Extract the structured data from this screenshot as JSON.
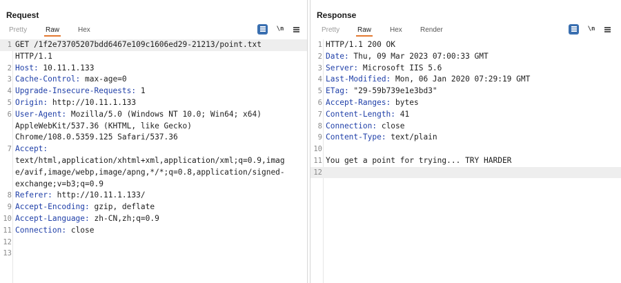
{
  "request": {
    "title": "Request",
    "tabs": [
      "Pretty",
      "Raw",
      "Hex"
    ],
    "active_tab": "Raw",
    "newline_label": "\\n",
    "lines": [
      {
        "num": "1",
        "key": "",
        "text": "GET /1f2e73705207bdd6467e109c1606ed29-21213/point.txt"
      },
      {
        "num": "",
        "key": "",
        "text": "HTTP/1.1"
      },
      {
        "num": "2",
        "key": "Host:",
        "text": " 10.11.1.133"
      },
      {
        "num": "3",
        "key": "Cache-Control:",
        "text": " max-age=0"
      },
      {
        "num": "4",
        "key": "Upgrade-Insecure-Requests:",
        "text": " 1"
      },
      {
        "num": "5",
        "key": "Origin:",
        "text": " http://10.11.1.133"
      },
      {
        "num": "6",
        "key": "User-Agent:",
        "text": " Mozilla/5.0 (Windows NT 10.0; Win64; x64)"
      },
      {
        "num": "",
        "key": "",
        "text": "AppleWebKit/537.36 (KHTML, like Gecko)"
      },
      {
        "num": "",
        "key": "",
        "text": "Chrome/108.0.5359.125 Safari/537.36"
      },
      {
        "num": "7",
        "key": "Accept:",
        "text": ""
      },
      {
        "num": "",
        "key": "",
        "text": "text/html,application/xhtml+xml,application/xml;q=0.9,imag"
      },
      {
        "num": "",
        "key": "",
        "text": "e/avif,image/webp,image/apng,*/*;q=0.8,application/signed-"
      },
      {
        "num": "",
        "key": "",
        "text": "exchange;v=b3;q=0.9"
      },
      {
        "num": "8",
        "key": "Referer:",
        "text": " http://10.11.1.133/"
      },
      {
        "num": "9",
        "key": "Accept-Encoding:",
        "text": " gzip, deflate"
      },
      {
        "num": "10",
        "key": "Accept-Language:",
        "text": " zh-CN,zh;q=0.9"
      },
      {
        "num": "11",
        "key": "Connection:",
        "text": " close"
      },
      {
        "num": "12",
        "key": "",
        "text": ""
      },
      {
        "num": "13",
        "key": "",
        "text": ""
      }
    ]
  },
  "response": {
    "title": "Response",
    "tabs": [
      "Pretty",
      "Raw",
      "Hex",
      "Render"
    ],
    "active_tab": "Raw",
    "newline_label": "\\n",
    "lines": [
      {
        "num": "1",
        "key": "",
        "text": "HTTP/1.1 200 OK"
      },
      {
        "num": "2",
        "key": "Date:",
        "text": " Thu, 09 Mar 2023 07:00:33 GMT"
      },
      {
        "num": "3",
        "key": "Server:",
        "text": " Microsoft IIS 5.6"
      },
      {
        "num": "4",
        "key": "Last-Modified:",
        "text": " Mon, 06 Jan 2020 07:29:19 GMT"
      },
      {
        "num": "5",
        "key": "ETag:",
        "text": " \"29-59b739e1e3bd3\""
      },
      {
        "num": "6",
        "key": "Accept-Ranges:",
        "text": " bytes"
      },
      {
        "num": "7",
        "key": "Content-Length:",
        "text": " 41"
      },
      {
        "num": "8",
        "key": "Connection:",
        "text": " close"
      },
      {
        "num": "9",
        "key": "Content-Type:",
        "text": " text/plain"
      },
      {
        "num": "10",
        "key": "",
        "text": ""
      },
      {
        "num": "11",
        "key": "",
        "text": "You get a point for trying... TRY HARDER"
      },
      {
        "num": "12",
        "key": "",
        "text": ""
      }
    ]
  },
  "colors": {
    "accent_tab": "#e3782f",
    "toggle_blue": "#3a6fb0",
    "header_key": "#1f3fa8"
  },
  "icons": {
    "pretty_toggle": "list-lines-icon",
    "menu": "hamburger-menu-icon",
    "layout_split": "split-view-icon",
    "layout_horizontal": "horizontal-view-icon",
    "layout_single": "single-view-icon"
  }
}
